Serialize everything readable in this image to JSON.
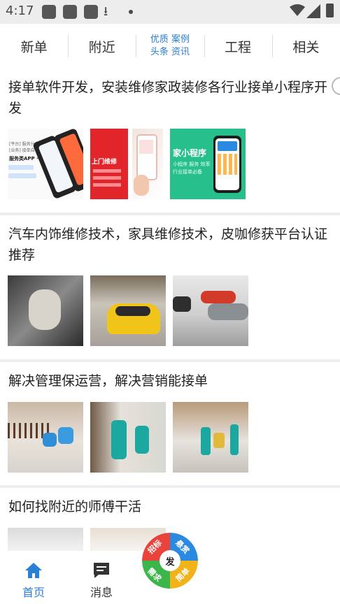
{
  "status_bar": {
    "time": "4:17"
  },
  "tabs": [
    {
      "label": "新单"
    },
    {
      "label": "附近"
    },
    {
      "line1": "优质 案例",
      "line2": "头条 资讯"
    },
    {
      "label": "工程"
    },
    {
      "label": "相关"
    }
  ],
  "posts": [
    {
      "title": "接单软件开发，安装维修家政装修各行业接单小程序开发"
    },
    {
      "title": "汽车内饰维修技术，家具维修技术，皮咖修获平台认证推荐"
    },
    {
      "title": "解决管理保运营，解决营销能接单"
    },
    {
      "title": "如何找附近的师傅干活"
    }
  ],
  "thumb_text": {
    "soft1_line1": "[平台] 服务分类",
    "soft1_line2": "[业务] 接单自营",
    "soft1_main": "服务类APP · 小程序",
    "red_main": "上门维修",
    "green_main": "家小程序",
    "green_sub": "小程序 服务 效率 行业接单必备"
  },
  "bottom_nav": {
    "home_label": "首页",
    "messages_label": "消息",
    "fab_center": "发",
    "fab_q1": "招标",
    "fab_q2": "悬赏",
    "fab_q3": "需求",
    "fab_q4": "简单"
  },
  "colors": {
    "accent": "#2a7fd6",
    "fab_red": "#e8443b",
    "fab_yellow": "#f1b21a",
    "fab_green": "#3cb64a",
    "fab_blue": "#2a8ae0"
  },
  "icons": [
    "download-icon",
    "wifi-icon",
    "signal-icon",
    "battery-icon",
    "home-icon",
    "message-icon"
  ]
}
